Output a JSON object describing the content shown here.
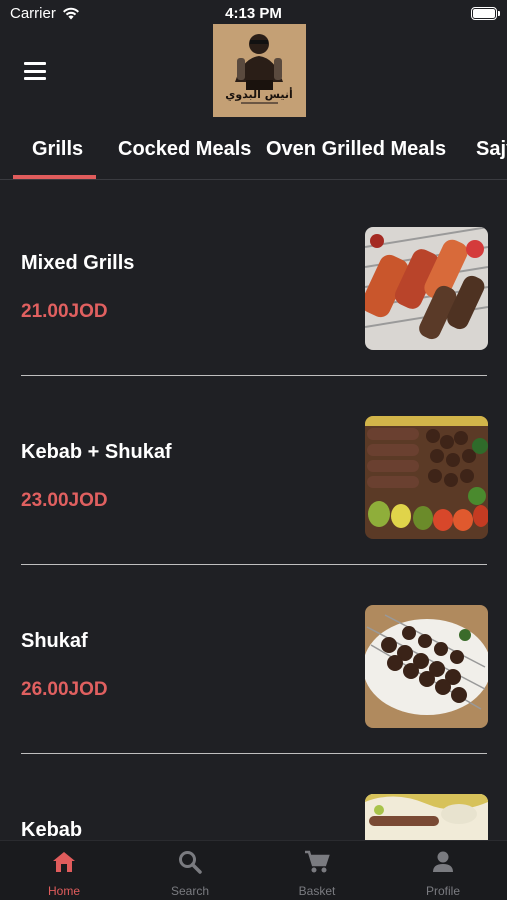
{
  "status_bar": {
    "carrier": "Carrier",
    "time": "4:13 PM"
  },
  "header": {
    "logo_alt": "أنيس البدوي"
  },
  "tabs": [
    {
      "label": "Grills"
    },
    {
      "label": "Cocked Meals"
    },
    {
      "label": "Oven Grilled Meals"
    },
    {
      "label": "Sajy"
    }
  ],
  "active_tab": "Grills",
  "items": [
    {
      "name": "Mixed Grills",
      "price": "21.00JOD"
    },
    {
      "name": "Kebab + Shukaf",
      "price": "23.00JOD"
    },
    {
      "name": "Shukaf",
      "price": "26.00JOD"
    },
    {
      "name": "Kebab",
      "price": ""
    }
  ],
  "tabbar": [
    {
      "label": "Home",
      "icon": "home-icon"
    },
    {
      "label": "Search",
      "icon": "search-icon"
    },
    {
      "label": "Basket",
      "icon": "cart-icon"
    },
    {
      "label": "Profile",
      "icon": "profile-icon"
    }
  ],
  "colors": {
    "accent": "#e05c5c",
    "background": "#1f2024",
    "tabbar_inactive": "#7a7b80"
  }
}
